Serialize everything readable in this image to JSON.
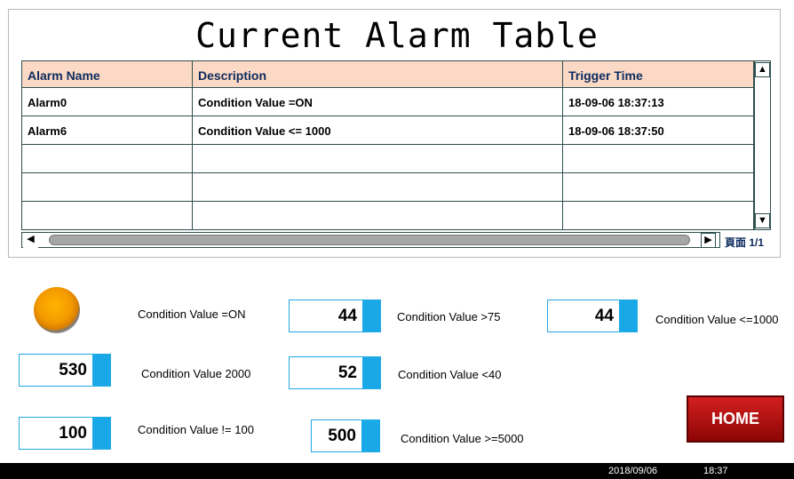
{
  "title": "Current Alarm Table",
  "table": {
    "columns": [
      "Alarm Name",
      "Description",
      "Trigger Time"
    ],
    "rows": [
      [
        "Alarm0",
        "Condition Value =ON",
        "18-09-06 18:37:13"
      ],
      [
        "Alarm6",
        "Condition Value <= 1000",
        "18-09-06 18:37:50"
      ],
      [
        "",
        "",
        ""
      ],
      [
        "",
        "",
        ""
      ],
      [
        "",
        "",
        ""
      ]
    ]
  },
  "scroll": {
    "up_icon": "arrow-up-icon",
    "down_icon": "arrow-down-icon",
    "left_icon": "arrow-left-icon",
    "right_icon": "arrow-right-icon"
  },
  "pager": {
    "label": "頁面 1/1"
  },
  "indicators": {
    "lamp_label": "Condition Value =ON",
    "lamp_color": "#f49a00",
    "accent_color": "#1aa9e8",
    "items": [
      {
        "value": "44",
        "label": "Condition Value >75"
      },
      {
        "value": "44",
        "label": "Condition Value  <=1000"
      },
      {
        "value": "530",
        "label": "Condition Value 2000"
      },
      {
        "value": "52",
        "label": "Condition Value  <40"
      },
      {
        "value": "100",
        "label": "Condition Value != 100"
      },
      {
        "value": "500",
        "label": "Condition Value  >=5000"
      }
    ]
  },
  "home_button": {
    "label": "HOME",
    "color": "#b01010"
  },
  "status": {
    "date": "2018/09/06",
    "time": "18:37"
  }
}
